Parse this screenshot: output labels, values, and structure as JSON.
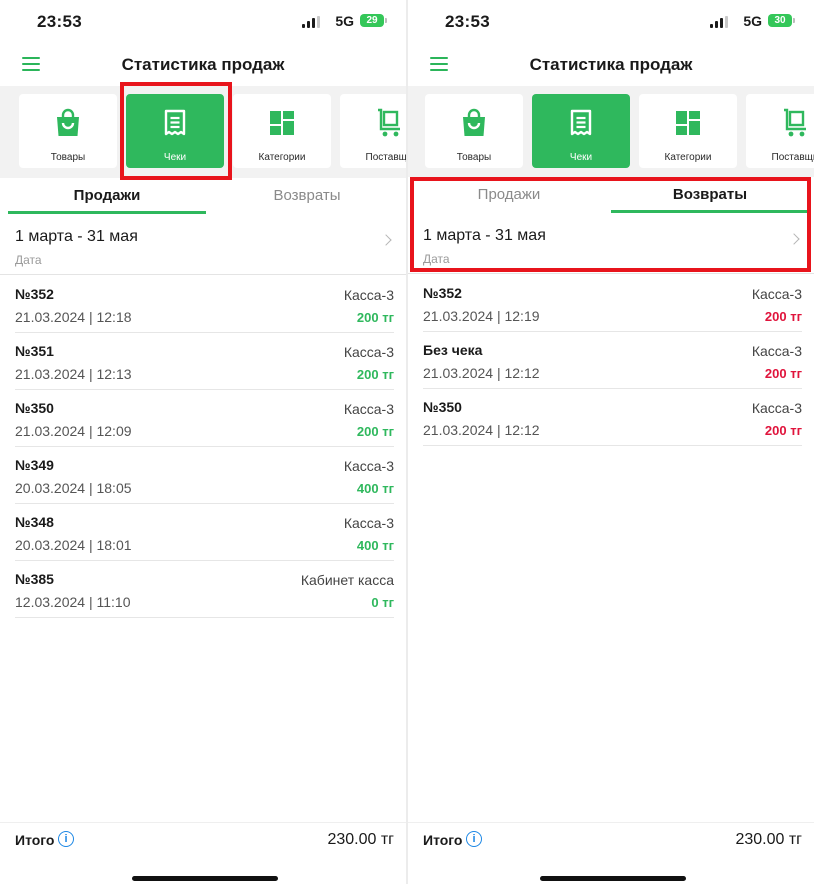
{
  "colors": {
    "accent": "#2fb85d",
    "positive": "#2fb85d",
    "negative": "#e0143c",
    "highlight": "#e8141c"
  },
  "screens": [
    {
      "status": {
        "time": "23:53",
        "network": "5G",
        "battery": "29"
      },
      "title": "Статистика продаж",
      "categories": [
        {
          "label": "Товары",
          "icon": "shopping-bag-icon"
        },
        {
          "label": "Чеки",
          "icon": "receipt-icon"
        },
        {
          "label": "Категории",
          "icon": "grid-icon"
        },
        {
          "label": "Поставщи",
          "icon": "cart-icon"
        }
      ],
      "tabs": [
        "Продажи",
        "Возвраты"
      ],
      "date": {
        "range": "1 марта - 31 мая",
        "label": "Дата"
      },
      "rows": [
        {
          "no": "№352",
          "datetime": "21.03.2024 | 12:18",
          "kassa": "Касса-3",
          "amount": "200 тг"
        },
        {
          "no": "№351",
          "datetime": "21.03.2024 | 12:13",
          "kassa": "Касса-3",
          "amount": "200 тг"
        },
        {
          "no": "№350",
          "datetime": "21.03.2024 | 12:09",
          "kassa": "Касса-3",
          "amount": "200 тг"
        },
        {
          "no": "№349",
          "datetime": "20.03.2024 | 18:05",
          "kassa": "Касса-3",
          "amount": "400 тг"
        },
        {
          "no": "№348",
          "datetime": "20.03.2024 | 18:01",
          "kassa": "Касса-3",
          "amount": "400 тг"
        },
        {
          "no": "№385",
          "datetime": "12.03.2024 | 11:10",
          "kassa": "Кабинет касса",
          "amount": "0 тг"
        }
      ],
      "footer": {
        "label": "Итого",
        "total": "230.00 тг"
      }
    },
    {
      "status": {
        "time": "23:53",
        "network": "5G",
        "battery": "30"
      },
      "title": "Статистика продаж",
      "categories": [
        {
          "label": "Товары",
          "icon": "shopping-bag-icon"
        },
        {
          "label": "Чеки",
          "icon": "receipt-icon"
        },
        {
          "label": "Категории",
          "icon": "grid-icon"
        },
        {
          "label": "Поставщи",
          "icon": "cart-icon"
        }
      ],
      "tabs": [
        "Продажи",
        "Возвраты"
      ],
      "date": {
        "range": "1 марта - 31 мая",
        "label": "Дата"
      },
      "rows": [
        {
          "no": "№352",
          "datetime": "21.03.2024 | 12:19",
          "kassa": "Касса-3",
          "amount": "200 тг"
        },
        {
          "no": "Без чека",
          "datetime": "21.03.2024 | 12:12",
          "kassa": "Касса-3",
          "amount": "200 тг"
        },
        {
          "no": "№350",
          "datetime": "21.03.2024 | 12:12",
          "kassa": "Касса-3",
          "amount": "200 тг"
        }
      ],
      "footer": {
        "label": "Итого",
        "total": "230.00 тг"
      }
    }
  ]
}
